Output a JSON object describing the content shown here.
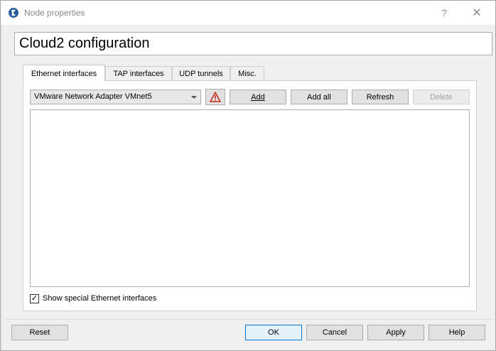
{
  "window": {
    "title": "Node properties",
    "help_glyph": "?",
    "close_glyph": "✕",
    "icon": "gns3-app-icon"
  },
  "header": {
    "title": "Cloud2 configuration"
  },
  "tabs": [
    {
      "label": "Ethernet interfaces",
      "active": true
    },
    {
      "label": "TAP interfaces",
      "active": false
    },
    {
      "label": "UDP tunnels",
      "active": false
    },
    {
      "label": "Misc.",
      "active": false
    }
  ],
  "ethernet": {
    "selected_adapter": "VMware Network Adapter VMnet5",
    "warning_icon": "warning-triangle-icon",
    "buttons": {
      "add": "Add",
      "add_all": "Add all",
      "refresh": "Refresh",
      "delete": "Delete"
    },
    "interfaces": [],
    "show_special_label": "Show special Ethernet interfaces",
    "show_special_checked": true
  },
  "footer": {
    "reset": "Reset",
    "ok": "OK",
    "cancel": "Cancel",
    "apply": "Apply",
    "help": "Help"
  },
  "colors": {
    "accent": "#0078d7",
    "warning": "#c42b1c"
  }
}
